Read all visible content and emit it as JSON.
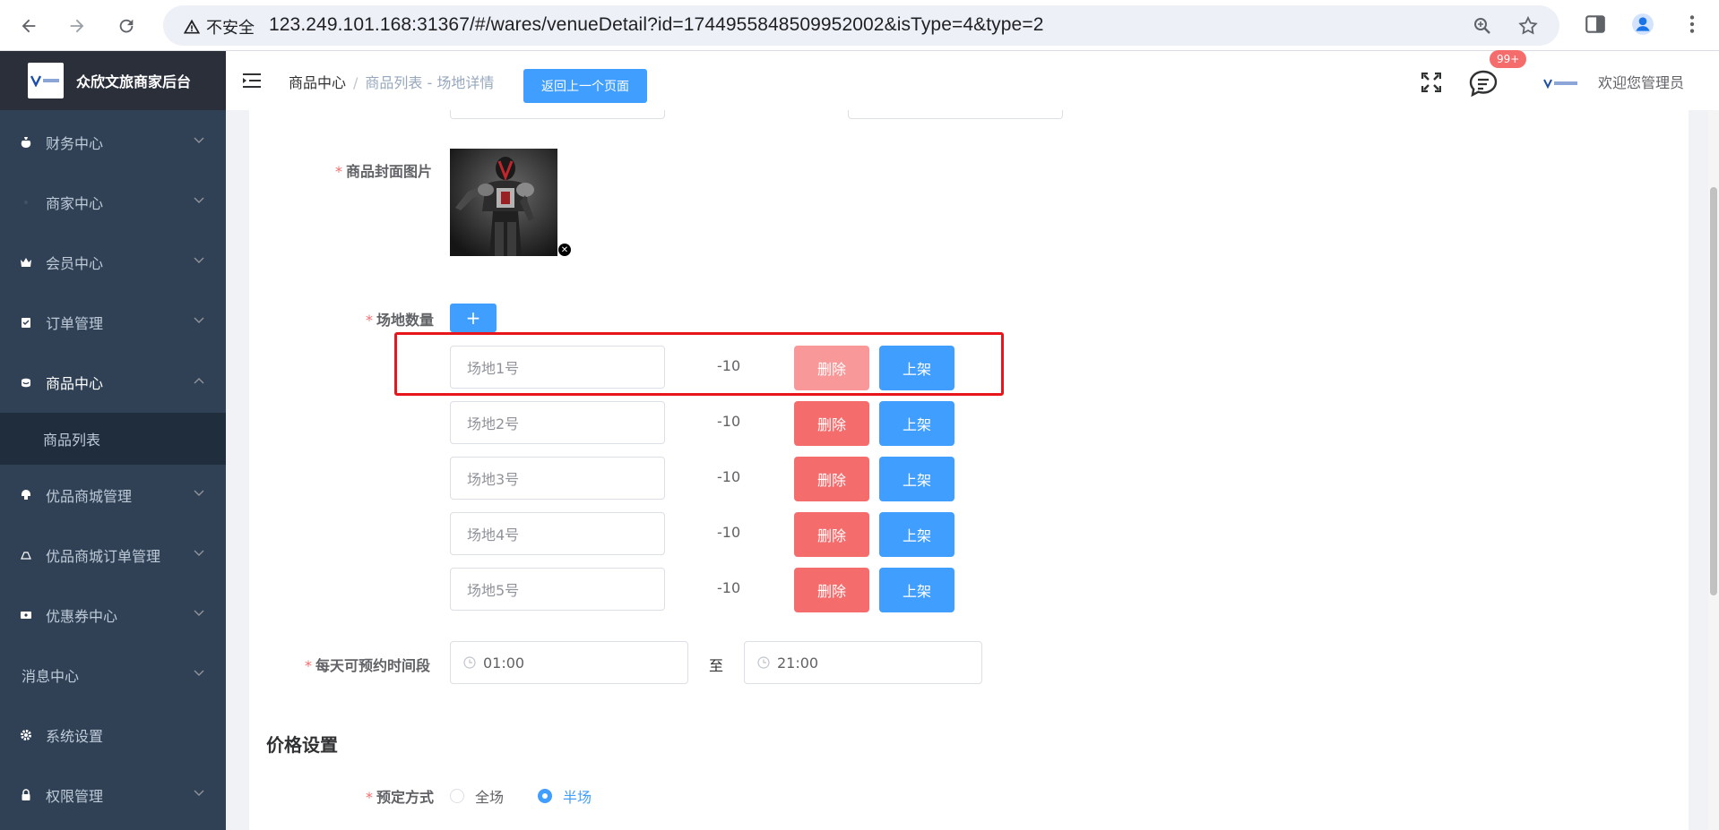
{
  "browser": {
    "security_text": "不安全",
    "url": "123.249.101.168:31367/#/wares/venueDetail?id=1744955848509952002&isType=4&type=2"
  },
  "app": {
    "title": "众欣文旅商家后台"
  },
  "sidebar": {
    "items": [
      {
        "label": "财务中心",
        "icon": "money-bag-icon"
      },
      {
        "label": "商家中心",
        "icon": "shop-icon"
      },
      {
        "label": "会员中心",
        "icon": "crown-icon"
      },
      {
        "label": "订单管理",
        "icon": "clipboard-icon"
      },
      {
        "label": "商品中心",
        "icon": "goods-icon"
      },
      {
        "label": "优品商城管理",
        "icon": "mall-icon"
      },
      {
        "label": "优品商城订单管理",
        "icon": "bag-icon"
      },
      {
        "label": "优惠券中心",
        "icon": "ticket-icon"
      },
      {
        "label": "消息中心",
        "icon": ""
      },
      {
        "label": "系统设置",
        "icon": "gear-icon"
      },
      {
        "label": "权限管理",
        "icon": "lock-icon"
      }
    ],
    "sub_item": "商品列表"
  },
  "header": {
    "breadcrumb_root": "商品中心",
    "breadcrumb_current": "商品列表 - 场地详情",
    "back_button": "返回上一个页面",
    "badge": "99+",
    "welcome": "欢迎您管理员"
  },
  "form": {
    "cover_label": "商品封面图片",
    "venue_count_label": "场地数量",
    "add_button": "+",
    "venues": [
      {
        "name": "场地1号",
        "num": "-10",
        "delete": "删除",
        "shelf": "上架"
      },
      {
        "name": "场地2号",
        "num": "-10",
        "delete": "删除",
        "shelf": "上架"
      },
      {
        "name": "场地3号",
        "num": "-10",
        "delete": "删除",
        "shelf": "上架"
      },
      {
        "name": "场地4号",
        "num": "-10",
        "delete": "删除",
        "shelf": "上架"
      },
      {
        "name": "场地5号",
        "num": "-10",
        "delete": "删除",
        "shelf": "上架"
      }
    ],
    "time_label": "每天可预约时间段",
    "time_start": "01:00",
    "time_sep": "至",
    "time_end": "21:00",
    "price_section": "价格设置",
    "booking_label": "预定方式",
    "booking_options": [
      "全场",
      "半场"
    ],
    "booking_selected": "半场"
  },
  "colors": {
    "primary": "#409eff",
    "danger": "#f56c6c",
    "sidebar_bg": "#304156",
    "highlight": "#e8151b"
  }
}
